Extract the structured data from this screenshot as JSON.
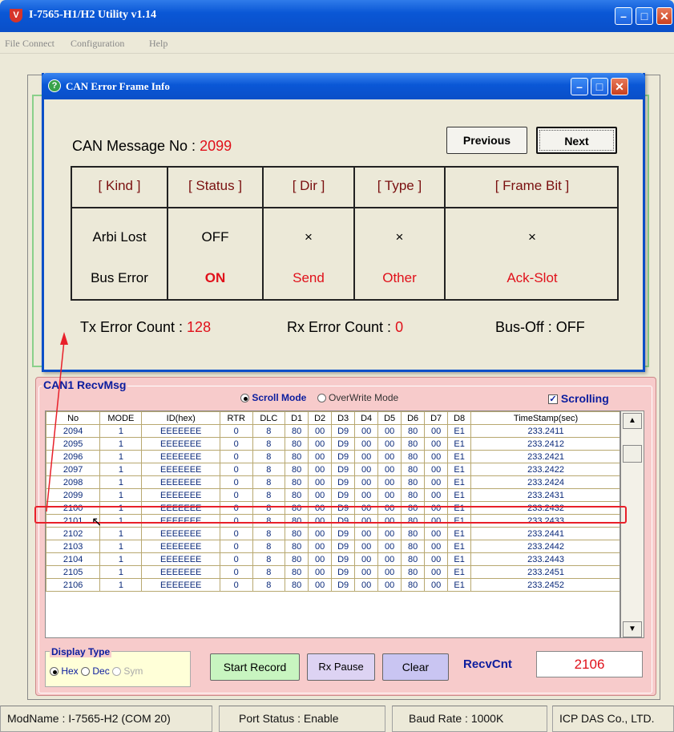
{
  "app": {
    "title": "I-7565-H1/H2 Utility v1.14",
    "logo": "shield-logo",
    "menu": [
      "File",
      "Connect",
      "Configuration",
      "Help"
    ]
  },
  "recv": {
    "title": "CAN1 RecvMsg",
    "scroll_mode": "Scroll Mode",
    "overwrite_mode": "OverWrite Mode",
    "scrolling": "Scrolling",
    "columns": [
      "No",
      "MODE",
      "ID(hex)",
      "RTR",
      "DLC",
      "D1",
      "D2",
      "D3",
      "D4",
      "D5",
      "D6",
      "D7",
      "D8",
      "TimeStamp(sec)"
    ],
    "rows": [
      [
        "2094",
        "1",
        "EEEEEEE",
        "0",
        "8",
        "80",
        "00",
        "D9",
        "00",
        "00",
        "80",
        "00",
        "E1",
        "233.2411"
      ],
      [
        "2095",
        "1",
        "EEEEEEE",
        "0",
        "8",
        "80",
        "00",
        "D9",
        "00",
        "00",
        "80",
        "00",
        "E1",
        "233.2412"
      ],
      [
        "2096",
        "1",
        "EEEEEEE",
        "0",
        "8",
        "80",
        "00",
        "D9",
        "00",
        "00",
        "80",
        "00",
        "E1",
        "233.2421"
      ],
      [
        "2097",
        "1",
        "EEEEEEE",
        "0",
        "8",
        "80",
        "00",
        "D9",
        "00",
        "00",
        "80",
        "00",
        "E1",
        "233.2422"
      ],
      [
        "2098",
        "1",
        "EEEEEEE",
        "0",
        "8",
        "80",
        "00",
        "D9",
        "00",
        "00",
        "80",
        "00",
        "E1",
        "233.2424"
      ],
      [
        "2099",
        "1",
        "EEEEEEE",
        "0",
        "8",
        "80",
        "00",
        "D9",
        "00",
        "00",
        "80",
        "00",
        "E1",
        "233.2431"
      ],
      [
        "2100",
        "1",
        "EEEEEEE",
        "0",
        "8",
        "80",
        "00",
        "D9",
        "00",
        "00",
        "80",
        "00",
        "E1",
        "233.2432"
      ],
      [
        "2101",
        "1",
        "EEEEEEE",
        "0",
        "8",
        "80",
        "00",
        "D9",
        "00",
        "00",
        "80",
        "00",
        "E1",
        "233.2433"
      ],
      [
        "2102",
        "1",
        "EEEEEEE",
        "0",
        "8",
        "80",
        "00",
        "D9",
        "00",
        "00",
        "80",
        "00",
        "E1",
        "233.2441"
      ],
      [
        "2103",
        "1",
        "EEEEEEE",
        "0",
        "8",
        "80",
        "00",
        "D9",
        "00",
        "00",
        "80",
        "00",
        "E1",
        "233.2442"
      ],
      [
        "2104",
        "1",
        "EEEEEEE",
        "0",
        "8",
        "80",
        "00",
        "D9",
        "00",
        "00",
        "80",
        "00",
        "E1",
        "233.2443"
      ],
      [
        "2105",
        "1",
        "EEEEEEE",
        "0",
        "8",
        "80",
        "00",
        "D9",
        "00",
        "00",
        "80",
        "00",
        "E1",
        "233.2451"
      ],
      [
        "2106",
        "1",
        "EEEEEEE",
        "0",
        "8",
        "80",
        "00",
        "D9",
        "00",
        "00",
        "80",
        "00",
        "E1",
        "233.2452"
      ]
    ],
    "highlighted_row": "2099"
  },
  "controls": {
    "display_type": "Display Type",
    "hex": "Hex",
    "dec": "Dec",
    "sym": "Sym",
    "start_record": "Start Record",
    "rx_pause": "Rx Pause",
    "clear": "Clear",
    "recvcnt_label": "RecvCnt",
    "recvcnt_value": "2106"
  },
  "status": {
    "modname": "ModName : I-7565-H2 (COM 20)",
    "port": "Port Status : Enable",
    "baud": "Baud Rate : 1000K",
    "company": "ICP DAS Co., LTD."
  },
  "dialog": {
    "title": "CAN Error Frame Info",
    "msg_label": "CAN Message No :",
    "msg_no": "2099",
    "previous": "Previous",
    "next": "Next",
    "headers": [
      "[ Kind ]",
      "[ Status ]",
      "[ Dir ]",
      "[ Type ]",
      "[ Frame Bit ]"
    ],
    "row1": [
      "Arbi Lost",
      "OFF",
      "×",
      "×",
      "×"
    ],
    "row2": [
      "Bus Error",
      "ON",
      "Send",
      "Other",
      "Ack-Slot"
    ],
    "tx_label": "Tx Error Count :",
    "tx_value": "128",
    "rx_label": "Rx Error Count :",
    "rx_value": "0",
    "busoff": "Bus-Off : OFF"
  },
  "colors": {
    "accent_red": "#e0101a",
    "title_blue": "#0a4fc8",
    "recv_bg": "#f7cbcb"
  }
}
